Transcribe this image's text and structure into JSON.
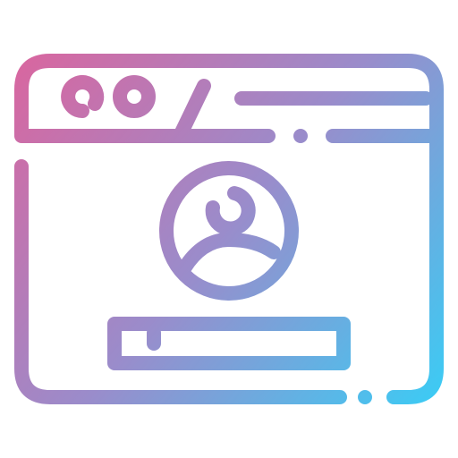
{
  "icon": {
    "name": "browser-user-profile-icon",
    "gradient": {
      "start_color": "#D9669F",
      "mid_color": "#9A8CCB",
      "end_color": "#3CCBF4"
    }
  }
}
